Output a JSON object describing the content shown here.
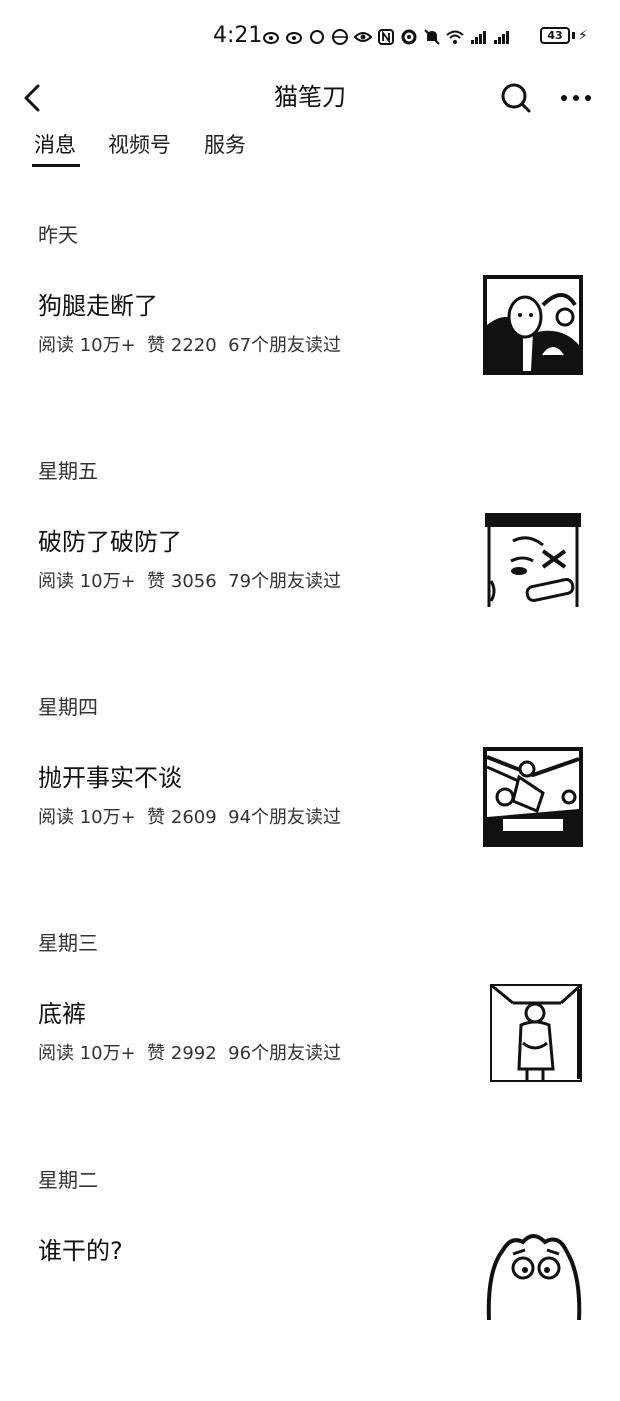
{
  "status_bar": {
    "time": "4:21",
    "battery": "43"
  },
  "header": {
    "title": "猫笔刀"
  },
  "tabs": [
    {
      "label": "消息",
      "active": true
    },
    {
      "label": "视频号",
      "active": false
    },
    {
      "label": "服务",
      "active": false
    }
  ],
  "sections": [
    {
      "day": "昨天",
      "article": {
        "title": "狗腿走断了",
        "reads": "阅读 10万+",
        "likes": "赞 2220",
        "friends": "67个朋友读过",
        "thumbnail_icon": "cartoon-thumbnail"
      }
    },
    {
      "day": "星期五",
      "article": {
        "title": "破防了破防了",
        "reads": "阅读 10万+",
        "likes": "赞 3056",
        "friends": "79个朋友读过",
        "thumbnail_icon": "cartoon-thumbnail"
      }
    },
    {
      "day": "星期四",
      "article": {
        "title": "抛开事实不谈",
        "reads": "阅读 10万+",
        "likes": "赞 2609",
        "friends": "94个朋友读过",
        "thumbnail_icon": "cartoon-thumbnail"
      }
    },
    {
      "day": "星期三",
      "article": {
        "title": "底裤",
        "reads": "阅读 10万+",
        "likes": "赞 2992",
        "friends": "96个朋友读过",
        "thumbnail_icon": "cartoon-thumbnail"
      }
    },
    {
      "day": "星期二",
      "article": {
        "title": "谁干的?",
        "reads": "",
        "likes": "",
        "friends": "",
        "thumbnail_icon": "cartoon-thumbnail"
      }
    }
  ],
  "colors": {
    "text": "#111111",
    "secondary": "#333333",
    "background": "#ffffff"
  }
}
